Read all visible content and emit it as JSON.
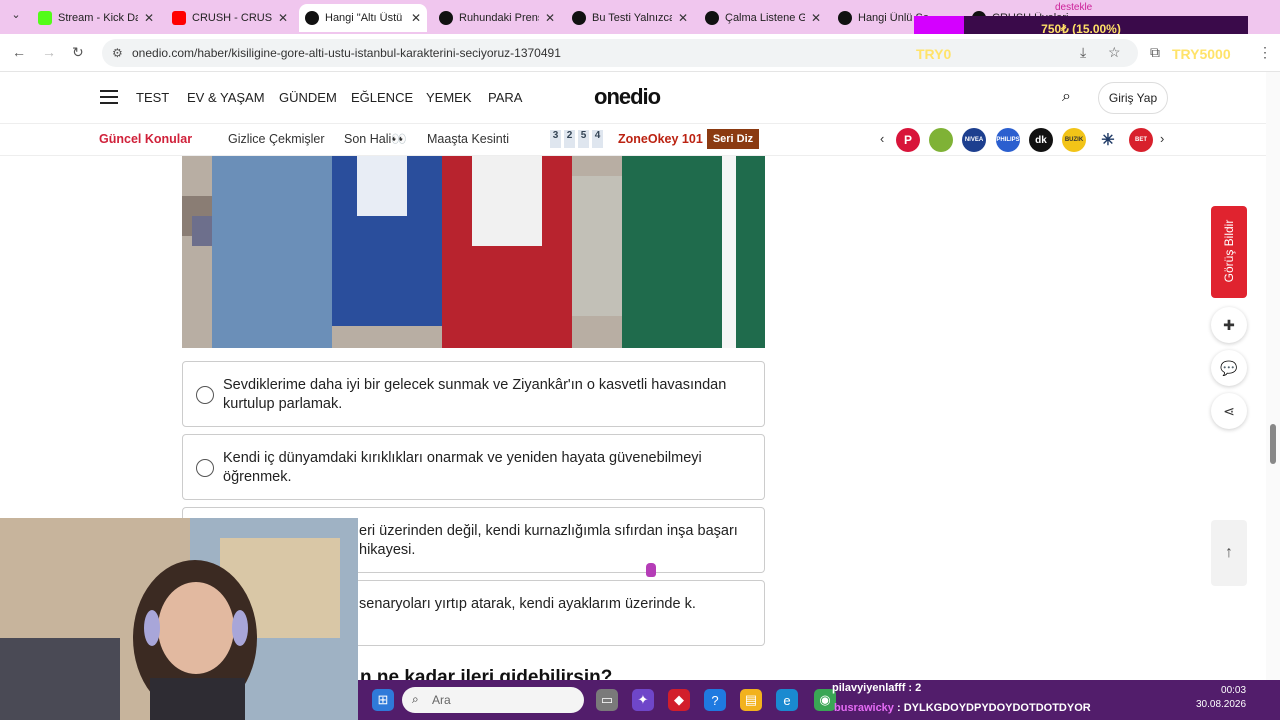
{
  "browser": {
    "tabs": [
      {
        "label": "Stream - Kick Da",
        "favicon_color": "#53fc18",
        "active": false
      },
      {
        "label": "CRUSH - CRUSH",
        "favicon_color": "#ff0000",
        "active": false
      },
      {
        "label": "Hangi \"Altı Üstü",
        "favicon_color": "#111111",
        "active": true
      },
      {
        "label": "Ruhundaki Prens",
        "favicon_color": "#111111",
        "active": false
      },
      {
        "label": "Bu Testi Yalnızca",
        "favicon_color": "#111111",
        "active": false
      },
      {
        "label": "Çalma Listene G",
        "favicon_color": "#111111",
        "active": false
      },
      {
        "label": "Hangi Ünlü Se",
        "favicon_color": "#111111",
        "active": false
      },
      {
        "label": "CRUSH Üyeleri",
        "favicon_color": "#111111",
        "active": false
      }
    ],
    "url": "onedio.com/haber/kisiligine-gore-alti-ustu-istanbul-karakterini-seciyoruz-1370491",
    "tab_close": "✕",
    "back": "←",
    "forward": "→",
    "reload": "↻"
  },
  "overlay": {
    "donation_top": "destekle",
    "donation_text": "750₺ (15.00%)",
    "donation_progress": 0.15,
    "donation_low": "TRY0",
    "donation_high": "TRY5000"
  },
  "site": {
    "logo": "onedio",
    "nav": [
      "TEST",
      "EV & YAŞAM",
      "GÜNDEM",
      "EĞLENCE",
      "YEMEK",
      "PARA"
    ],
    "login": "Giriş Yap",
    "topics_hot": "Güncel Konular",
    "topics": [
      "Gizlice Çekmişler",
      "Son Hali👀",
      "Maaşta Kesinti"
    ],
    "numbers": [
      "3",
      "2",
      "5",
      "4"
    ],
    "zone": "ZoneOkey 101",
    "seri": "Seri Diz",
    "brands": [
      {
        "label": "P",
        "color": "#d8143a"
      },
      {
        "label": "",
        "color": "#7fb236"
      },
      {
        "label": "NIVEA",
        "color": "#1d3f8f"
      },
      {
        "label": "PHILIPS",
        "color": "#2b5fcf"
      },
      {
        "label": "dk",
        "color": "#111111"
      },
      {
        "label": "BUZIK",
        "color": "#f2c418"
      },
      {
        "label": "✳",
        "color": "#1f3a66"
      },
      {
        "label": "BET",
        "color": "#d8202c"
      }
    ]
  },
  "quiz": {
    "options": [
      {
        "text": "Sevdiklerime daha iyi bir gelecek sunmak ve Ziyankâr'ın o kasvetli havasından kurtulup parlamak."
      },
      {
        "text": "Kendi iç dünyamdaki kırıklıkları onarmak ve yeniden hayata güvenebilmeyi öğrenmek."
      },
      {
        "text": "eri üzerinden değil, kendi kurnazlığımla sıfırdan inşa başarı hikayesi."
      },
      {
        "text": "senaryoları yırtıp atarak, kendi ayaklarım üzerinde k."
      }
    ],
    "next_question": "n ne kadar ileri gidebilirsin?"
  },
  "sidebar": {
    "feedback": "Görüş Bildir"
  },
  "taskbar": {
    "search_placeholder": "Ara",
    "time": "00:03",
    "date": "30.08.2026"
  },
  "chat": {
    "line1": "pilavyiyenlafff : 2",
    "line2_user": "busrawicky",
    "line2_msg": " : DYLKGDOYDPYDOYDOTDOTDYOR"
  }
}
